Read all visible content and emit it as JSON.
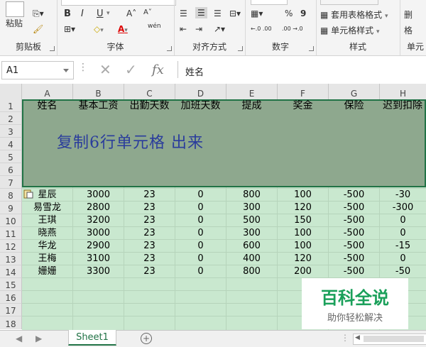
{
  "ribbon": {
    "groups": {
      "clipboard": {
        "label": "剪贴板",
        "paste": "粘贴"
      },
      "font": {
        "label": "字体",
        "bold": "B",
        "italic": "I",
        "underline": "U",
        "grow": "A˄",
        "shrink": "A˅",
        "wen": "wén"
      },
      "align": {
        "label": "对齐方式"
      },
      "number": {
        "label": "数字",
        "percent": "%",
        "comma": "9",
        "inc": "←.0 .00",
        "dec": ".00 →.0"
      },
      "styles": {
        "label": "样式",
        "table_format": "套用表格格式",
        "cell_style": "单元格样式"
      },
      "cells": {
        "label": "单元",
        "delete": "删",
        "format": "格"
      }
    }
  },
  "formula_bar": {
    "name_box": "A1",
    "content": "姓名",
    "fx": "fx"
  },
  "columns": [
    "A",
    "B",
    "C",
    "D",
    "E",
    "F",
    "G",
    "H"
  ],
  "rows": [
    "1",
    "2",
    "3",
    "4",
    "5",
    "6",
    "7",
    "8",
    "9",
    "10",
    "11",
    "12",
    "13",
    "14",
    "15",
    "16",
    "17",
    "18"
  ],
  "headers": [
    "姓名",
    "基本工资",
    "出勤天数",
    "加班天数",
    "提成",
    "奖金",
    "保险",
    "迟到扣除"
  ],
  "annotation": "复制6行单元格 出来",
  "data_rows": [
    [
      "星辰",
      "3000",
      "23",
      "0",
      "800",
      "100",
      "-500",
      "-30"
    ],
    [
      "易雪龙",
      "2800",
      "23",
      "0",
      "300",
      "120",
      "-500",
      "-300"
    ],
    [
      "王琪",
      "3200",
      "23",
      "0",
      "500",
      "150",
      "-500",
      "0"
    ],
    [
      "晓燕",
      "3000",
      "23",
      "0",
      "300",
      "100",
      "-500",
      "0"
    ],
    [
      "华龙",
      "2900",
      "23",
      "0",
      "600",
      "100",
      "-500",
      "-15"
    ],
    [
      "王梅",
      "3100",
      "23",
      "0",
      "400",
      "120",
      "-500",
      "0"
    ],
    [
      "姗姗",
      "3300",
      "23",
      "0",
      "800",
      "200",
      "-500",
      "-50"
    ]
  ],
  "watermark": {
    "title": "百科全说",
    "subtitle": "助你轻松解决"
  },
  "sheets": {
    "active": "Sheet1",
    "add": "+"
  }
}
